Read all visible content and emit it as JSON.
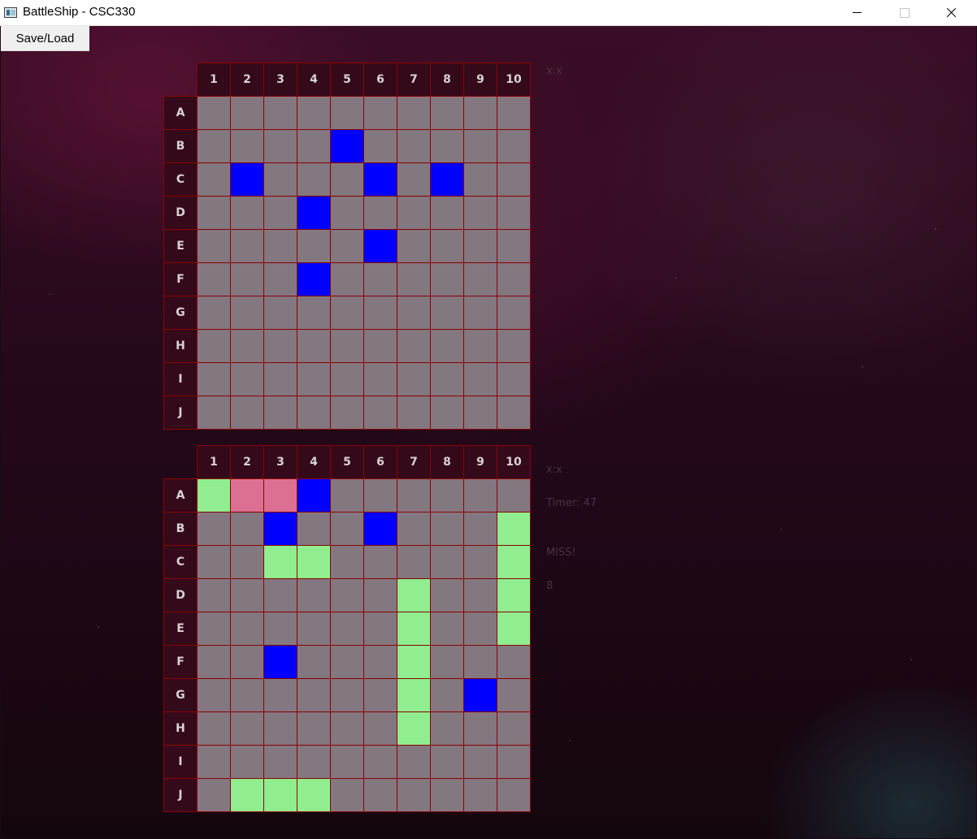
{
  "window": {
    "title": "BattleShip - CSC330"
  },
  "menu": {
    "save_load_label": "Save/Load"
  },
  "boards": {
    "top": {
      "col_headers": [
        "1",
        "2",
        "3",
        "4",
        "5",
        "6",
        "7",
        "8",
        "9",
        "10"
      ],
      "row_headers": [
        "A",
        "B",
        "C",
        "D",
        "E",
        "F",
        "G",
        "H",
        "I",
        "J"
      ],
      "grid": [
        "..........",
        "....S.....",
        ".S...S.S..",
        "...S......",
        ".....S....",
        "...S......",
        "..........",
        "..........",
        "..........",
        ".........."
      ]
    },
    "bottom": {
      "col_headers": [
        "1",
        "2",
        "3",
        "4",
        "5",
        "6",
        "7",
        "8",
        "9",
        "10"
      ],
      "row_headers": [
        "A",
        "B",
        "C",
        "D",
        "E",
        "F",
        "G",
        "H",
        "I",
        "J"
      ],
      "grid": [
        "HMMS......",
        "..S..S...H",
        "..HH.....H",
        "......H..H",
        "......H..H",
        "..S...H...",
        "......H.S.",
        "......H...",
        "..........",
        ".HHH......"
      ]
    }
  },
  "status": {
    "top_coord": "x:x",
    "bottom_coord": "x:x",
    "timer": "Timer: 47",
    "result": "MISS!",
    "count": "8"
  },
  "legend": {
    "ship": "S",
    "hit": "H",
    "miss": "M",
    "empty": "."
  },
  "colors": {
    "empty": "#837780",
    "ship": "#0000ff",
    "hit": "#90ee90",
    "miss": "#db7093",
    "grid_border": "#8b0000",
    "header_bg": "#340a1a"
  }
}
